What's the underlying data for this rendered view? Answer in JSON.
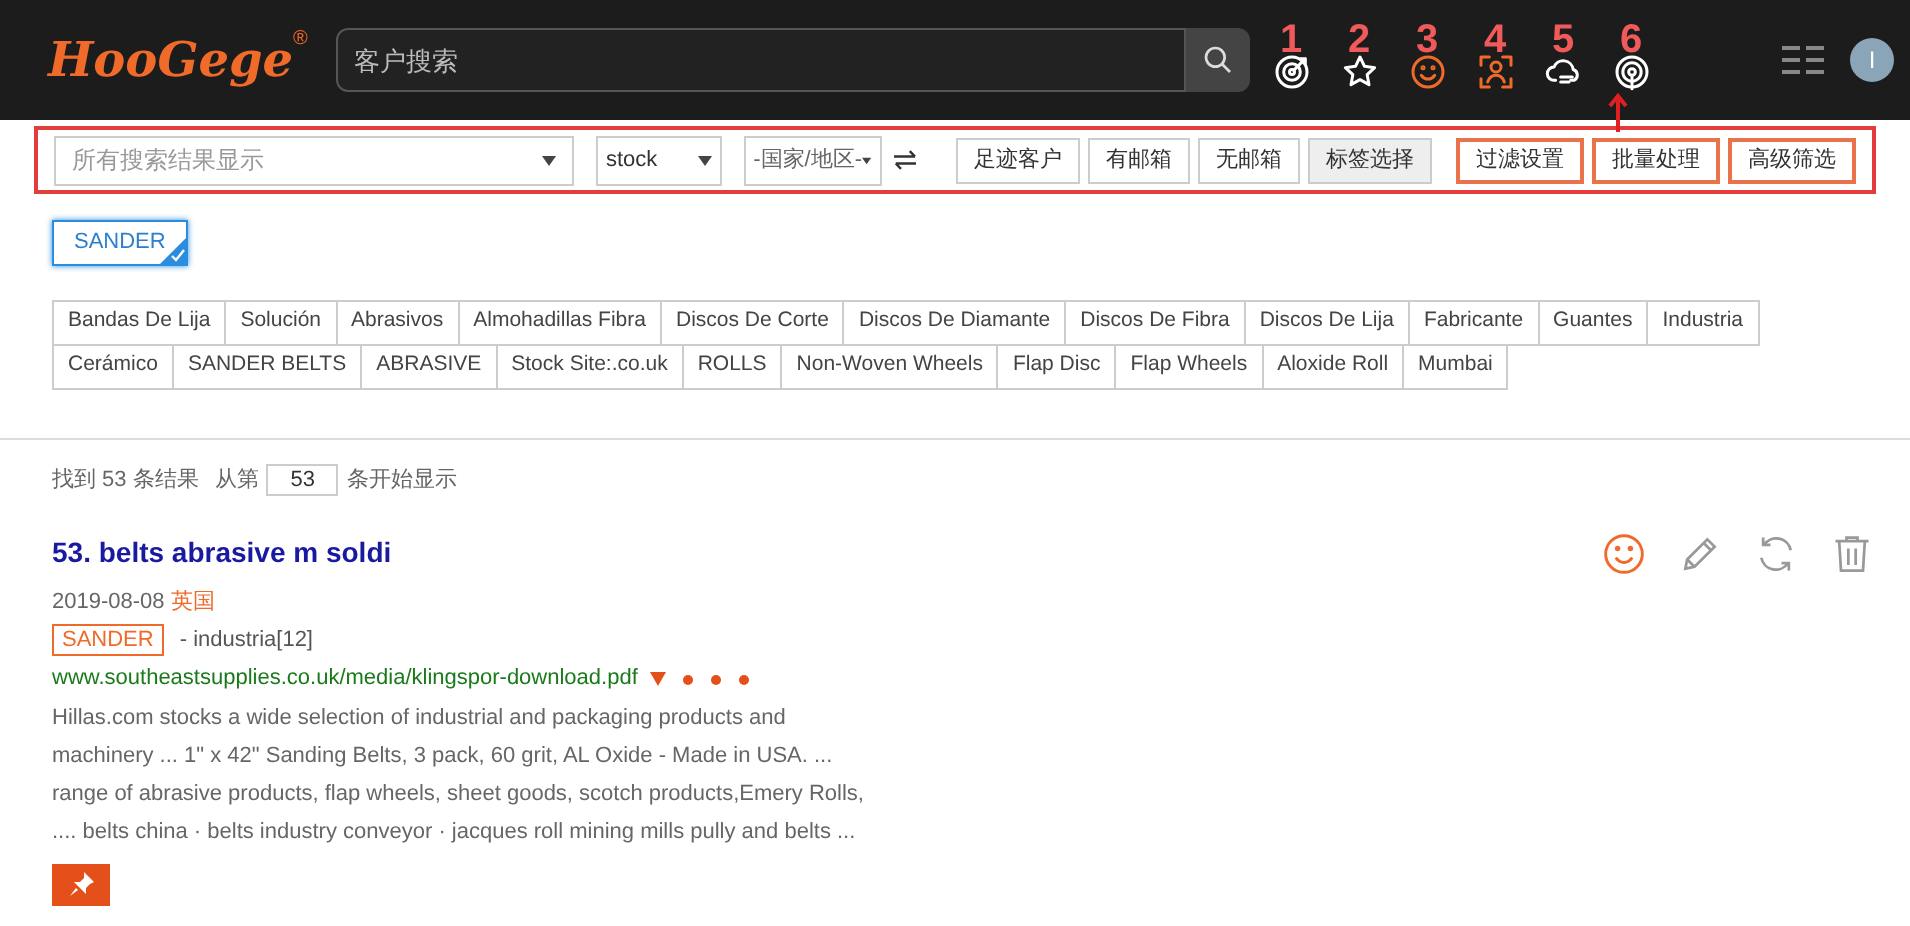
{
  "header": {
    "logo": "HooGege",
    "logo_mark": "®",
    "search": {
      "placeholder": "客户搜索"
    },
    "tools": [
      {
        "number": "1",
        "kind": "target",
        "active": false
      },
      {
        "number": "2",
        "kind": "star",
        "active": false
      },
      {
        "number": "3",
        "kind": "smile",
        "active": true
      },
      {
        "number": "4",
        "kind": "person",
        "active": true
      },
      {
        "number": "5",
        "kind": "cloud",
        "active": false
      },
      {
        "number": "6",
        "kind": "signal",
        "active": false
      }
    ],
    "avatar": "I"
  },
  "filters": {
    "scope": "所有搜索结果显示",
    "keyword": "stock",
    "country": "-国家/地区-",
    "buttons": [
      {
        "label": "足迹客户",
        "highlighted": false,
        "gray": false
      },
      {
        "label": "有邮箱",
        "highlighted": false,
        "gray": false
      },
      {
        "label": "无邮箱",
        "highlighted": false,
        "gray": false
      },
      {
        "label": "标签选择",
        "highlighted": false,
        "gray": true
      },
      {
        "label": "过滤设置",
        "highlighted": true,
        "gray": false
      },
      {
        "label": "批量处理",
        "highlighted": true,
        "gray": false
      },
      {
        "label": "高级筛选",
        "highlighted": true,
        "gray": false
      }
    ]
  },
  "selected_tag": {
    "label": "SANDER",
    "selected": true
  },
  "keywords": [
    [
      "Bandas De Lija",
      "Solución",
      "Abrasivos",
      "Almohadillas Fibra",
      "Discos De Corte",
      "Discos De Diamante",
      "Discos De Fibra",
      "Discos De Lija",
      "Fabricante",
      "Guantes",
      "Industria"
    ],
    [
      "Cerámico",
      "SANDER BELTS",
      "ABRASIVE",
      "Stock Site:.co.uk",
      "ROLLS",
      "Non-Woven Wheels",
      "Flap Disc",
      "Flap Wheels",
      "Aloxide Roll",
      "Mumbai"
    ]
  ],
  "results_info": {
    "prefix": "找到 53 条结果",
    "from_label": "从第",
    "start": "53",
    "suffix": "条开始显示"
  },
  "result": {
    "title": "53. belts abrasive m soldi",
    "date": "2019-08-08",
    "country": "英国",
    "tag": "SANDER",
    "category": "- industria[12]",
    "url": "www.southeastsupplies.co.uk/media/klingspor-download.pdf",
    "snippet": [
      "Hillas.com stocks a wide selection of industrial and packaging products and",
      "machinery ... 1\" x 42\" Sanding Belts, 3 pack, 60 grit, AL Oxide - Made in USA. ...",
      "range of abrasive products, flap wheels, sheet goods, scotch products,Emery Rolls,",
      ".... belts china · belts industry conveyor · jacques roll mining mills pully and belts ..."
    ]
  }
}
